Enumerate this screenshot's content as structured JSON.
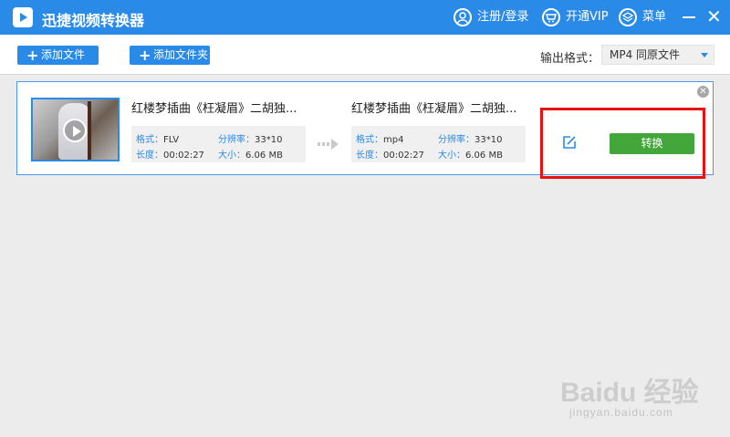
{
  "app": {
    "title": "迅捷视频转换器"
  },
  "titlebar": {
    "login_label": "注册/登录",
    "vip_label": "开通VIP",
    "menu_label": "菜单"
  },
  "toolbar": {
    "add_file_label": "添加文件",
    "add_folder_label": "添加文件夹",
    "output_format_label": "输出格式：",
    "output_format_value": "MP4 同原文件"
  },
  "file": {
    "source": {
      "name": "红楼梦插曲《枉凝眉》二胡独...",
      "format_key": "格式：",
      "format_val": "FLV",
      "res_key": "分辨率：",
      "res_val": "33*10",
      "len_key": "长度：",
      "len_val": "00:02:27",
      "size_key": "大小：",
      "size_val": "6.06 MB"
    },
    "target": {
      "name": "红楼梦插曲《枉凝眉》二胡独...",
      "format_key": "格式：",
      "format_val": "mp4",
      "res_key": "分辨率：",
      "res_val": "33*10",
      "len_key": "长度：",
      "len_val": "00:02:27",
      "size_key": "大小：",
      "size_val": "6.06 MB"
    },
    "convert_label": "转换"
  },
  "watermark": {
    "logo": "Baidu 经验",
    "url": "jingyan.baidu.com"
  },
  "colors": {
    "accent": "#2a8ae8",
    "convert": "#43a63a",
    "highlight": "#e81010"
  }
}
